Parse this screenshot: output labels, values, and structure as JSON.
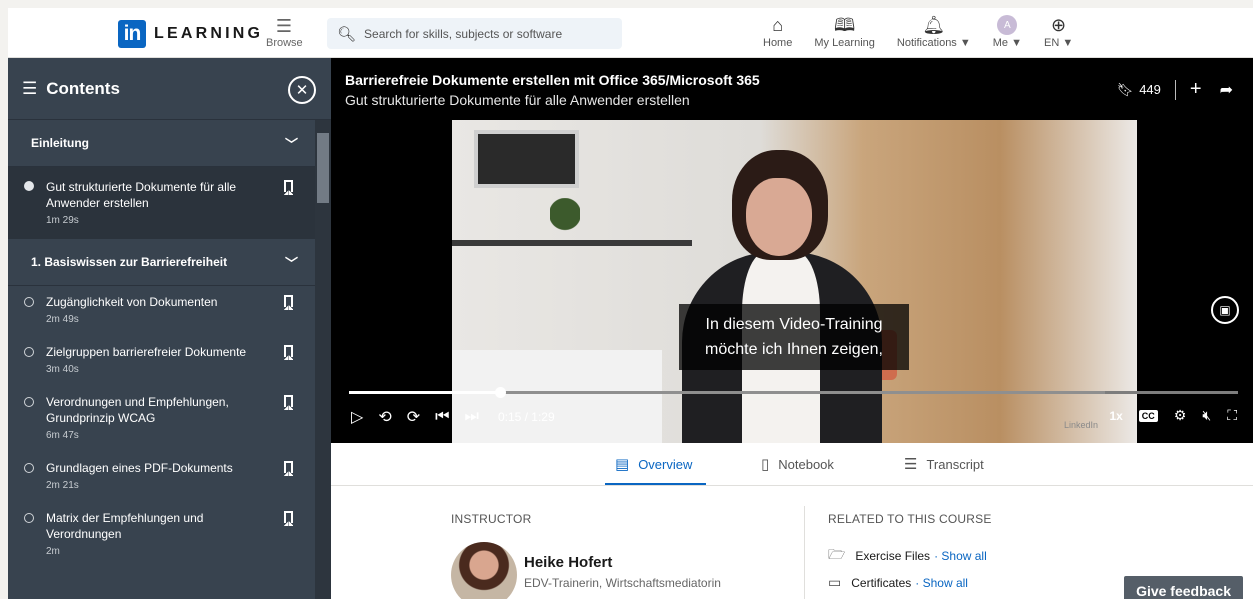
{
  "nav": {
    "logo_mark": "in",
    "logo_text": "LEARNING",
    "browse_label": "Browse",
    "search_placeholder": "Search for skills, subjects or software",
    "items": [
      {
        "label": "Home",
        "icon": "home-icon"
      },
      {
        "label": "My Learning",
        "icon": "book-icon"
      },
      {
        "label": "Notifications ▼",
        "icon": "bell-icon"
      },
      {
        "label": "Me ▼",
        "icon": "avatar"
      },
      {
        "label": "EN ▼",
        "icon": "globe-icon"
      }
    ],
    "avatar_initial": "A"
  },
  "sidebar": {
    "title": "Contents",
    "sections": [
      {
        "title": "Einleitung",
        "items": [
          {
            "title": "Gut strukturierte Dokumente für alle Anwender erstellen",
            "duration": "1m 29s",
            "active": true
          }
        ]
      },
      {
        "title": "1. Basiswissen zur Barrierefreiheit",
        "items": [
          {
            "title": "Zugänglichkeit von Dokumenten",
            "duration": "2m 49s"
          },
          {
            "title": "Zielgruppen barrierefreier Dokumente",
            "duration": "3m 40s"
          },
          {
            "title": "Verordnungen und Empfehlungen, Grundprinzip WCAG",
            "duration": "6m 47s"
          },
          {
            "title": "Grundlagen eines PDF-Dokuments",
            "duration": "2m 21s"
          },
          {
            "title": "Matrix der Empfehlungen und Verordnungen",
            "duration": "2m"
          }
        ]
      }
    ]
  },
  "video": {
    "course_title": "Barrierefreie Dokumente erstellen mit Office 365/Microsoft 365",
    "video_title": "Gut strukturierte Dokumente für alle Anwender erstellen",
    "save_count": "449",
    "caption_line1": "In diesem Video-Training",
    "caption_line2": "möchte ich Ihnen zeigen,",
    "time": "0:15 / 1:29",
    "progress": 0.17,
    "buffered": 0.85,
    "speed": "1x",
    "cc": "CC",
    "watermark": "LinkedIn"
  },
  "tabs": [
    {
      "label": "Overview",
      "icon": "overview-icon",
      "active": true
    },
    {
      "label": "Notebook",
      "icon": "notebook-icon"
    },
    {
      "label": "Transcript",
      "icon": "transcript-icon"
    }
  ],
  "instructor": {
    "label": "INSTRUCTOR",
    "name": "Heike Hofert",
    "role": "EDV-Trainerin, Wirtschaftsmediatorin"
  },
  "related": {
    "label": "RELATED TO THIS COURSE",
    "rows": [
      {
        "label": "Exercise Files",
        "link": "· Show all"
      },
      {
        "label": "Certificates",
        "link": "· Show all"
      }
    ]
  },
  "feedback_label": "Give feedback",
  "colors": {
    "brand": "#0a66c2",
    "sidebar": "#38434f"
  }
}
